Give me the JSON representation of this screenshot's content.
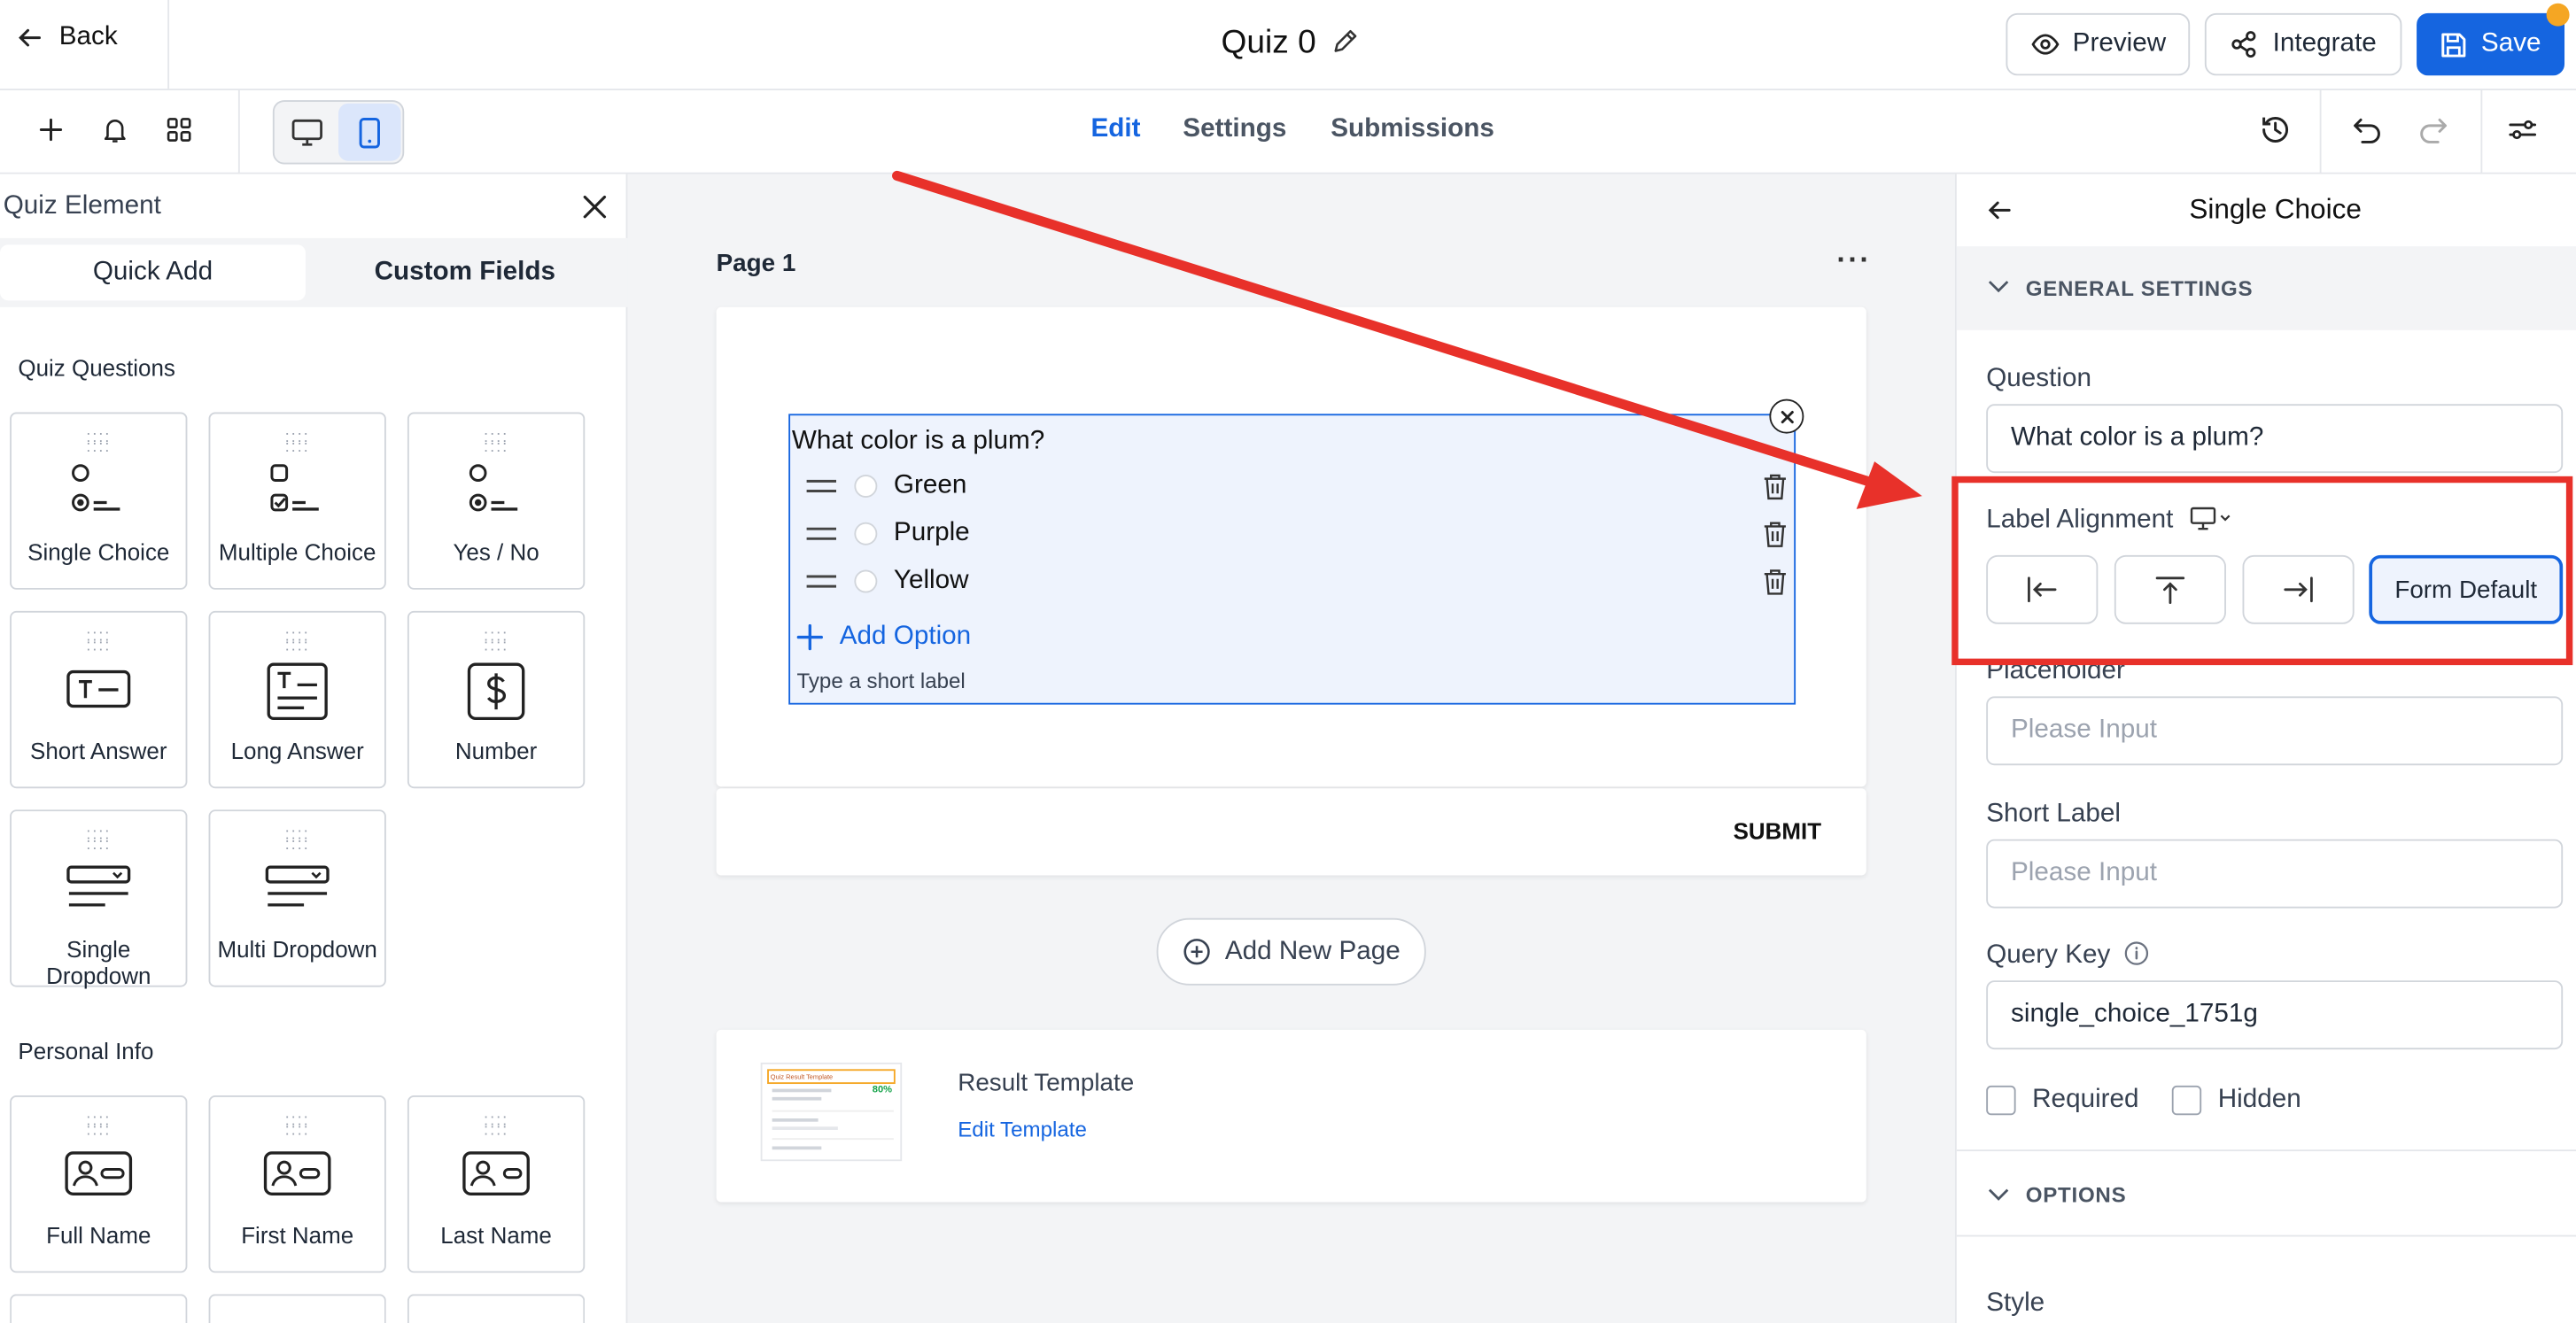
{
  "header": {
    "back_label": "Back",
    "quiz_title": "Quiz 0",
    "preview_label": "Preview",
    "integrate_label": "Integrate",
    "save_label": "Save"
  },
  "toolbar": {
    "tabs": [
      {
        "label": "Edit"
      },
      {
        "label": "Settings"
      },
      {
        "label": "Submissions"
      }
    ],
    "active_tab": "Edit"
  },
  "left_panel": {
    "title": "Quiz Element",
    "tabs": [
      {
        "label": "Quick Add"
      },
      {
        "label": "Custom Fields"
      }
    ],
    "quiz_section": "Quiz Questions",
    "quiz_items": [
      {
        "label": "Single Choice",
        "icon": "single-choice-icon"
      },
      {
        "label": "Multiple Choice",
        "icon": "multiple-choice-icon"
      },
      {
        "label": "Yes / No",
        "icon": "yes-no-icon"
      },
      {
        "label": "Short Answer",
        "icon": "short-answer-icon"
      },
      {
        "label": "Long Answer",
        "icon": "long-answer-icon"
      },
      {
        "label": "Number",
        "icon": "number-icon"
      },
      {
        "label": "Single Dropdown",
        "icon": "single-dropdown-icon"
      },
      {
        "label": "Multi Dropdown",
        "icon": "multi-dropdown-icon"
      }
    ],
    "personal_section": "Personal Info",
    "personal_items": [
      {
        "label": "Full Name",
        "icon": "full-name-icon"
      },
      {
        "label": "First Name",
        "icon": "first-name-icon"
      },
      {
        "label": "Last Name",
        "icon": "last-name-icon"
      }
    ]
  },
  "canvas": {
    "page_label": "Page 1",
    "question": "What color is a plum?",
    "options": [
      {
        "label": "Green"
      },
      {
        "label": "Purple"
      },
      {
        "label": "Yellow"
      }
    ],
    "add_option_label": "Add Option",
    "short_label_placeholder": "Type a short label",
    "submit_label": "SUBMIT",
    "add_page_label": "Add New Page",
    "result_template_title": "Result Template",
    "edit_template_label": "Edit Template",
    "thumbnail": {
      "title": "Quiz Result Template",
      "score": "80%"
    }
  },
  "right_panel": {
    "title": "Single Choice",
    "general_settings": "GENERAL SETTINGS",
    "question_label": "Question",
    "question_value": "What color is a plum?",
    "label_alignment": "Label Alignment",
    "form_default": "Form Default",
    "placeholder_label": "Placeholder",
    "placeholder_value": "Please Input",
    "short_label_label": "Short Label",
    "short_label_value": "Please Input",
    "query_key_label": "Query Key",
    "query_key_value": "single_choice_1751g",
    "required_label": "Required",
    "hidden_label": "Hidden",
    "options_section": "OPTIONS",
    "style_label": "Style"
  },
  "colors": {
    "accent": "#1565e0",
    "annotation": "#e8312a",
    "selected_bg": "#eef3fd"
  }
}
